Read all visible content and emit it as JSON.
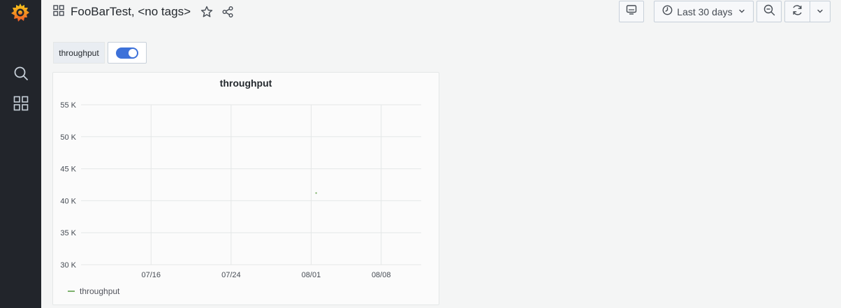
{
  "header": {
    "title": "FooBarTest, <no tags>",
    "time_range": "Last 30 days"
  },
  "variable": {
    "label": "throughput",
    "toggle_on": true
  },
  "panel": {
    "title": "throughput",
    "legend": [
      {
        "name": "throughput",
        "color": "#7eb26d"
      }
    ]
  },
  "chart_data": {
    "type": "line",
    "title": "throughput",
    "xlabel": "",
    "ylabel": "",
    "y_ticks": [
      "55 K",
      "50 K",
      "45 K",
      "40 K",
      "35 K",
      "30 K"
    ],
    "y_tick_values": [
      55000,
      50000,
      45000,
      40000,
      35000,
      30000
    ],
    "x_ticks": [
      "07/16",
      "07/24",
      "08/01",
      "08/08"
    ],
    "x_tick_dates": [
      "2023-07-16",
      "2023-07-24",
      "2023-08-01",
      "2023-08-08"
    ],
    "ylim": [
      30000,
      55000
    ],
    "grid": true,
    "legend_position": "bottom-left",
    "series": [
      {
        "name": "throughput",
        "color": "#7eb26d",
        "x": [
          "2023-08-01 12:00"
        ],
        "values": [
          41200
        ]
      }
    ]
  },
  "colors": {
    "sidebar_bg": "#22252b",
    "accent": "#3d71d9",
    "series": "#7eb26d"
  },
  "icons": [
    "grafana-logo-icon",
    "search-icon",
    "dashboards-icon",
    "dashboard-grid-icon",
    "star-icon",
    "share-icon",
    "tv-icon",
    "clock-icon",
    "chevron-down-icon",
    "zoom-out-icon",
    "refresh-icon"
  ]
}
